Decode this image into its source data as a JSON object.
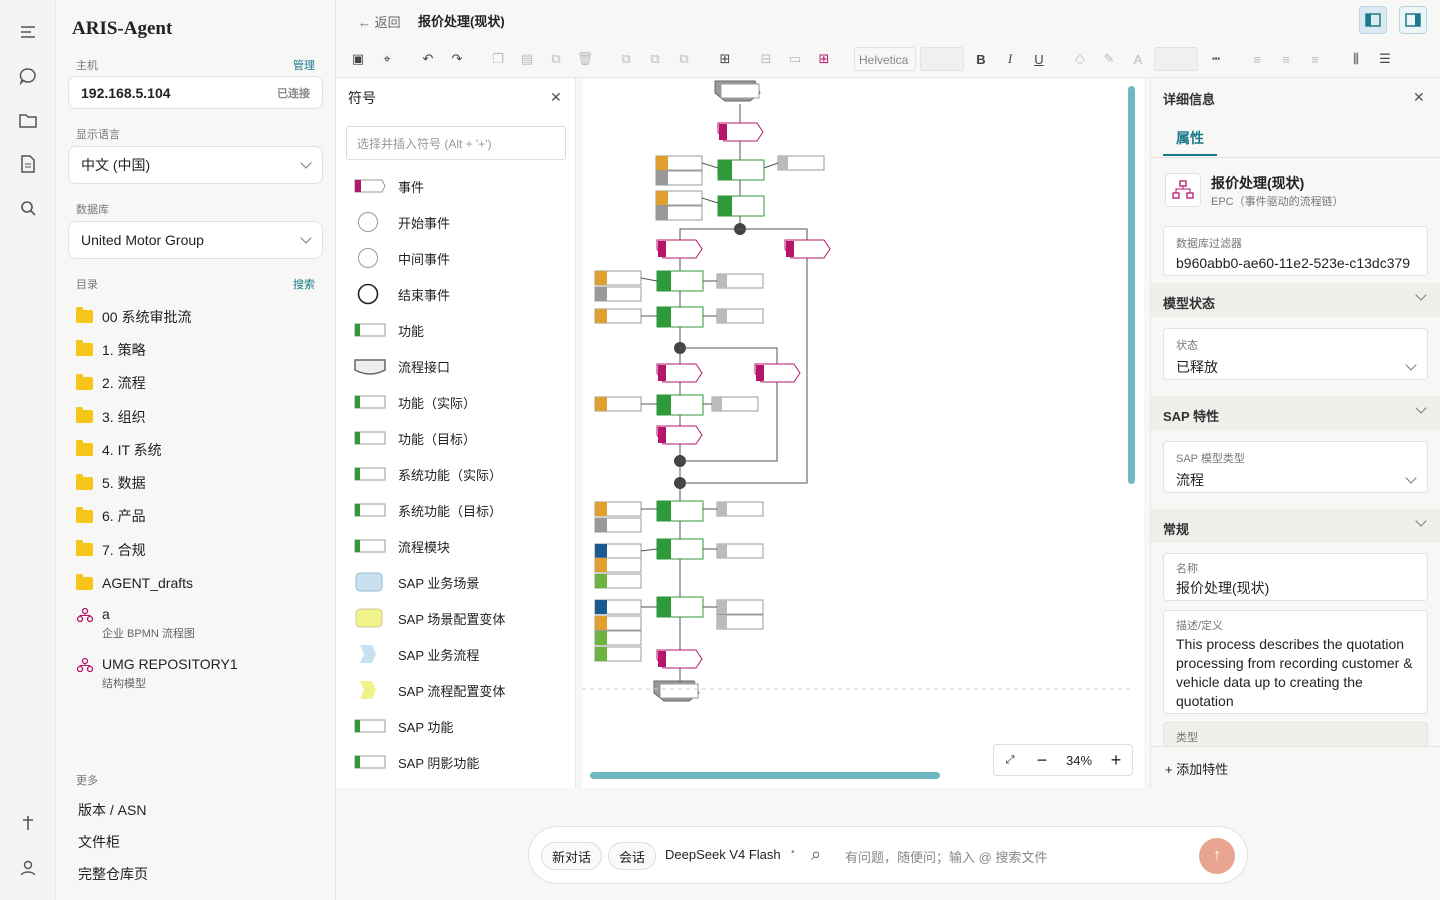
{
  "app": {
    "brand": "ARIS-Agent"
  },
  "sidebar": {
    "host_label": "主机",
    "host_manage": "管理",
    "host_value": "192.168.5.104",
    "host_status": "已连接",
    "lang_label": "显示语言",
    "lang_value": "中文 (中国)",
    "db_label": "数据库",
    "db_value": "United Motor Group",
    "dir_label": "目录",
    "dir_search": "搜索",
    "folders": [
      "00 系统审批流",
      "1. 策略",
      "2. 流程",
      "3. 组织",
      "4. IT 系统",
      "5. 数据",
      "6. 产品",
      "7. 合规",
      "AGENT_drafts"
    ],
    "models": [
      {
        "name": "a",
        "type": "企业 BPMN 流程图"
      },
      {
        "name": "UMG REPOSITORY1",
        "type": "结构模型"
      }
    ],
    "more_label": "更多",
    "more": [
      "版本 / ASN",
      "文件柜",
      "完整仓库页"
    ]
  },
  "header": {
    "back": "返回",
    "title": "报价处理(现状)"
  },
  "toolbar": {
    "font": "Helvetica"
  },
  "symbols": {
    "title": "符号",
    "search_placeholder": "选择并插入符号 (Alt + '+')",
    "items": [
      "事件",
      "开始事件",
      "中间事件",
      "结束事件",
      "功能",
      "流程接口",
      "功能（实际）",
      "功能（目标）",
      "系统功能（实际）",
      "系统功能（目标）",
      "流程模块",
      "SAP 业务场景",
      "SAP 场景配置变体",
      "SAP 业务流程",
      "SAP 流程配置变体",
      "SAP 功能",
      "SAP 阴影功能"
    ]
  },
  "canvas": {
    "zoom": "34%"
  },
  "details": {
    "title": "详细信息",
    "tab": "属性",
    "model_name": "报价处理(现状)",
    "model_type": "EPC（事件驱动的流程链）",
    "filter_label": "数据库过滤器",
    "filter_value": "b960abb0-ae60-11e2-523e-c13dc379",
    "sec_state": "模型状态",
    "state_label": "状态",
    "state_value": "已释放",
    "sec_sap": "SAP 特性",
    "sap_label": "SAP 模型类型",
    "sap_value": "流程",
    "sec_general": "常规",
    "name_label": "名称",
    "name_value": "报价处理(现状)",
    "desc_label": "描述/定义",
    "desc_value": "This process describes the quotation processing from recording customer & vehicle data up to creating the quotation",
    "type_label": "类型",
    "add_attr": "添加特性"
  },
  "chat": {
    "new_chat": "新对话",
    "session": "会话",
    "model": "DeepSeek V4 Flash",
    "placeholder": "有问题，随便问；输入 @ 搜索文件"
  },
  "colors": {
    "accent": "#1a7a8c",
    "event": "#b5166b",
    "function": "#2e9a3a",
    "org": "#e0a030",
    "send": "#e8a58f"
  }
}
